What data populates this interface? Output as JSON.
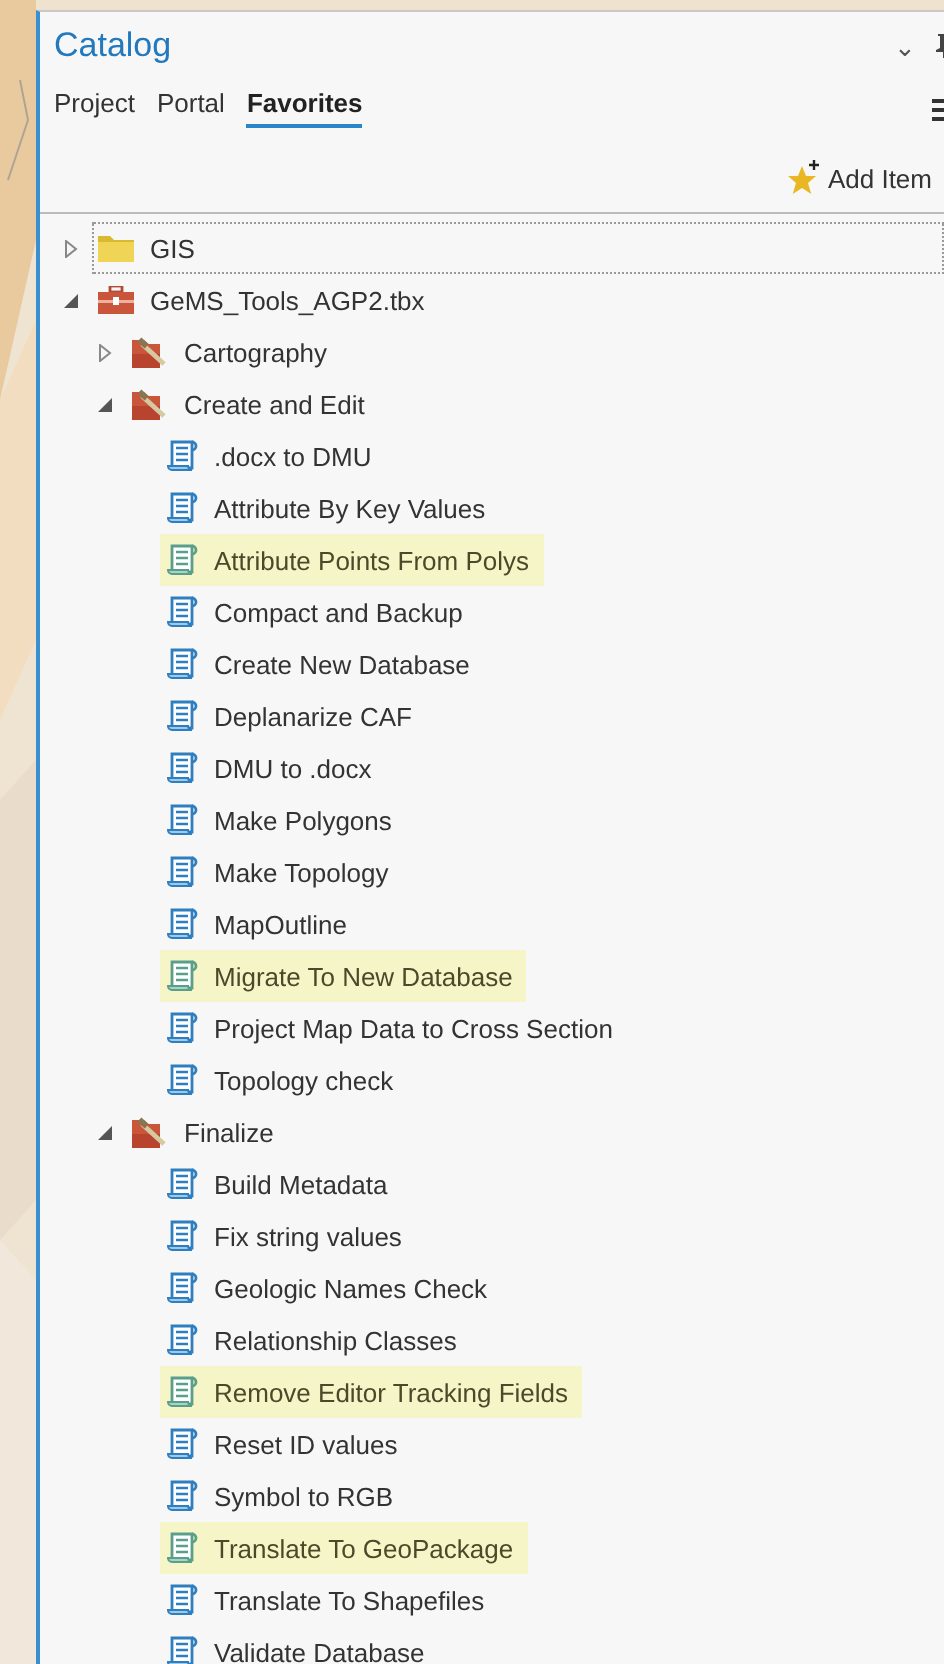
{
  "panel": {
    "title": "Catalog",
    "collapse_glyph": "⌄"
  },
  "tabs": [
    {
      "label": "Project",
      "selected": false
    },
    {
      "label": "Portal",
      "selected": false
    },
    {
      "label": "Favorites",
      "selected": true
    }
  ],
  "toolbar": {
    "add_item": "Add Item"
  },
  "tree": [
    {
      "label": "GIS",
      "kind": "folder",
      "expanded": false,
      "focused": true
    },
    {
      "label": "GeMS_Tools_AGP2.tbx",
      "kind": "toolbox",
      "expanded": true,
      "focused": false,
      "children": [
        {
          "label": "Cartography",
          "kind": "toolset",
          "expanded": false
        },
        {
          "label": "Create and Edit",
          "kind": "toolset",
          "expanded": true,
          "children": [
            {
              "label": ".docx to DMU",
              "kind": "script",
              "highlighted": false
            },
            {
              "label": "Attribute By Key Values",
              "kind": "script",
              "highlighted": false
            },
            {
              "label": "Attribute Points From Polys",
              "kind": "script",
              "highlighted": true
            },
            {
              "label": "Compact and Backup",
              "kind": "script",
              "highlighted": false
            },
            {
              "label": "Create New Database",
              "kind": "script",
              "highlighted": false
            },
            {
              "label": "Deplanarize CAF",
              "kind": "script",
              "highlighted": false
            },
            {
              "label": "DMU to .docx",
              "kind": "script",
              "highlighted": false
            },
            {
              "label": "Make Polygons",
              "kind": "script",
              "highlighted": false
            },
            {
              "label": "Make Topology",
              "kind": "script",
              "highlighted": false
            },
            {
              "label": "MapOutline",
              "kind": "script",
              "highlighted": false
            },
            {
              "label": "Migrate To New Database",
              "kind": "script",
              "highlighted": true
            },
            {
              "label": "Project Map Data to Cross Section",
              "kind": "script",
              "highlighted": false
            },
            {
              "label": "Topology check",
              "kind": "script",
              "highlighted": false
            }
          ]
        },
        {
          "label": "Finalize",
          "kind": "toolset",
          "expanded": true,
          "children": [
            {
              "label": "Build Metadata",
              "kind": "script",
              "highlighted": false
            },
            {
              "label": "Fix string values",
              "kind": "script",
              "highlighted": false
            },
            {
              "label": "Geologic Names Check",
              "kind": "script",
              "highlighted": false
            },
            {
              "label": "Relationship Classes",
              "kind": "script",
              "highlighted": false
            },
            {
              "label": "Remove Editor Tracking Fields",
              "kind": "script",
              "highlighted": true
            },
            {
              "label": "Reset ID values",
              "kind": "script",
              "highlighted": false
            },
            {
              "label": "Symbol to RGB",
              "kind": "script",
              "highlighted": false
            },
            {
              "label": "Translate To GeoPackage",
              "kind": "script",
              "highlighted": true
            },
            {
              "label": "Translate To Shapefiles",
              "kind": "script",
              "highlighted": false
            },
            {
              "label": "Validate Database",
              "kind": "script",
              "highlighted": false
            }
          ]
        }
      ]
    }
  ]
}
